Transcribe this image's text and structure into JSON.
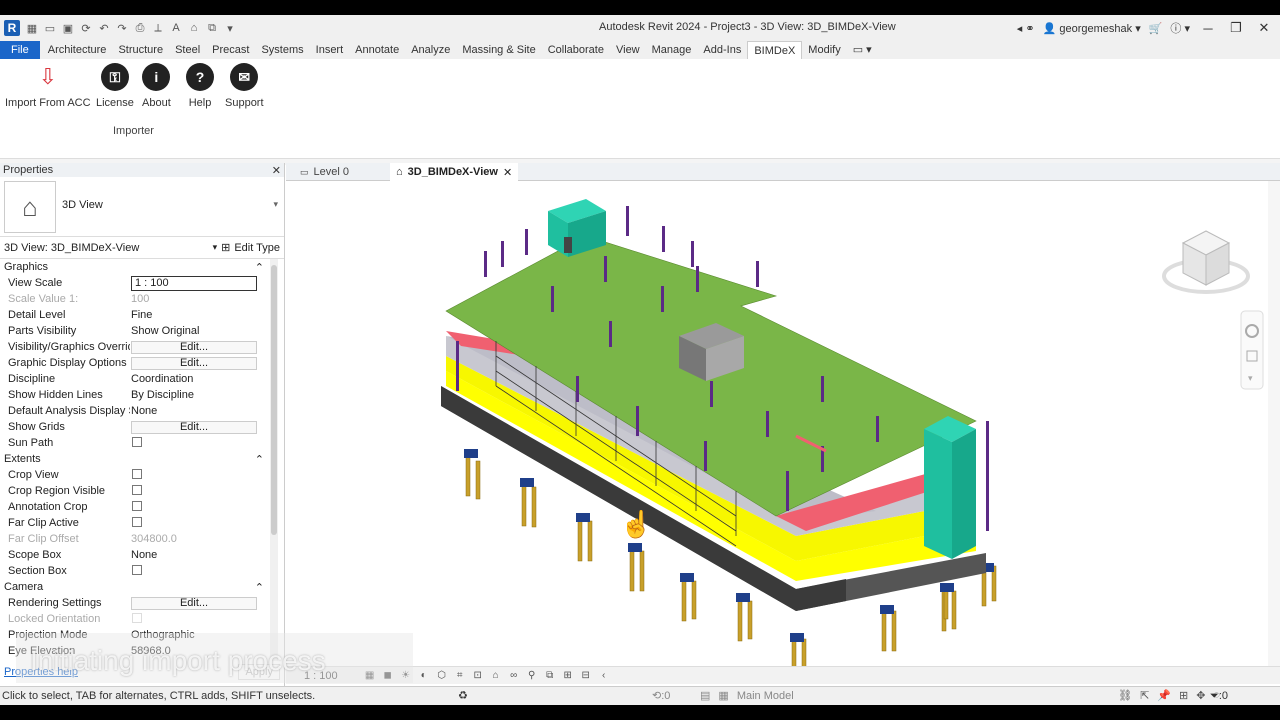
{
  "title": "Autodesk Revit 2024 - Project3 - 3D View: 3D_BIMDeX-View",
  "app_logo": "R",
  "user": "georgemeshak",
  "ribbon_tabs": [
    "File",
    "Architecture",
    "Structure",
    "Steel",
    "Precast",
    "Systems",
    "Insert",
    "Annotate",
    "Analyze",
    "Massing & Site",
    "Collaborate",
    "View",
    "Manage",
    "Add-Ins",
    "BIMDeX",
    "Modify"
  ],
  "active_tab": "BIMDeX",
  "ribbon_buttons": {
    "import": "Import From ACC",
    "license": "License",
    "about": "About",
    "help": "Help",
    "support": "Support"
  },
  "ribbon_panel": "Importer",
  "properties": {
    "title": "Properties",
    "type_name": "3D View",
    "view_selector": "3D View: 3D_BIMDeX-View",
    "edit_type": "Edit Type",
    "help_link": "Properties help",
    "apply": "Apply",
    "sections": {
      "graphics": "Graphics",
      "extents": "Extents",
      "camera": "Camera"
    },
    "rows": {
      "view_scale": {
        "k": "View Scale",
        "v": "1 : 100"
      },
      "scale_value": {
        "k": "Scale Value   1:",
        "v": "100"
      },
      "detail_level": {
        "k": "Detail Level",
        "v": "Fine"
      },
      "parts_visibility": {
        "k": "Parts Visibility",
        "v": "Show Original"
      },
      "vg_overrides": {
        "k": "Visibility/Graphics Overrid...",
        "v": "Edit..."
      },
      "graphic_display": {
        "k": "Graphic Display Options",
        "v": "Edit..."
      },
      "discipline": {
        "k": "Discipline",
        "v": "Coordination"
      },
      "hidden_lines": {
        "k": "Show Hidden Lines",
        "v": "By Discipline"
      },
      "analysis_display": {
        "k": "Default Analysis Display S...",
        "v": "None"
      },
      "show_grids": {
        "k": "Show Grids",
        "v": "Edit..."
      },
      "sun_path": {
        "k": "Sun Path",
        "v": ""
      },
      "crop_view": {
        "k": "Crop View",
        "v": ""
      },
      "crop_region_visible": {
        "k": "Crop Region Visible",
        "v": ""
      },
      "annotation_crop": {
        "k": "Annotation Crop",
        "v": ""
      },
      "far_clip_active": {
        "k": "Far Clip Active",
        "v": ""
      },
      "far_clip_offset": {
        "k": "Far Clip Offset",
        "v": "304800.0"
      },
      "scope_box": {
        "k": "Scope Box",
        "v": "None"
      },
      "section_box": {
        "k": "Section Box",
        "v": ""
      },
      "rendering_settings": {
        "k": "Rendering Settings",
        "v": "Edit..."
      },
      "locked_orientation": {
        "k": "Locked Orientation",
        "v": ""
      },
      "projection_mode": {
        "k": "Projection Mode",
        "v": "Orthographic"
      },
      "eye_elevation": {
        "k": "Eye Elevation",
        "v": "58968.0"
      }
    }
  },
  "view_tabs": {
    "level0": "Level 0",
    "view3d": "3D_BIMDeX-View"
  },
  "view_scale": "1 : 100",
  "status": {
    "hint": "Click to select, TAB for alternates, CTRL adds, SHIFT unselects.",
    "worksets": ":0",
    "model": "Main Model",
    "filter": ":0"
  },
  "overlay_text": "Initiating import process",
  "colors": {
    "slab": "#7ab648",
    "core": "#1fbf9f",
    "beam_yellow": "#ffff00",
    "red": "#f06070",
    "gray": "#c8c8d0",
    "column": "#5b2a86",
    "foundation": "#c8a02a"
  }
}
